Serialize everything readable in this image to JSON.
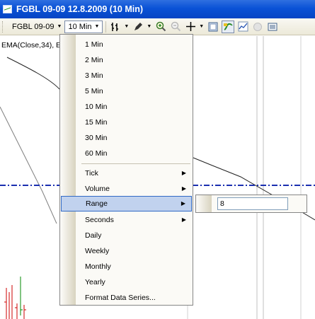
{
  "window": {
    "title": "FGBL 09-09  12.8.2009 (10 Min)"
  },
  "toolbar": {
    "instrument_label": "FGBL 09-09",
    "interval_label": "10 Min"
  },
  "chart": {
    "indicator_label": "EMA(Close,34), E"
  },
  "menu": {
    "items": [
      {
        "label": "1 Min"
      },
      {
        "label": "2 Min"
      },
      {
        "label": "3 Min"
      },
      {
        "label": "5 Min"
      },
      {
        "label": "10 Min"
      },
      {
        "label": "15 Min"
      },
      {
        "label": "30 Min"
      },
      {
        "label": "60 Min"
      },
      {
        "label": "Tick"
      },
      {
        "label": "Volume"
      },
      {
        "label": "Range"
      },
      {
        "label": "Seconds"
      },
      {
        "label": "Daily"
      },
      {
        "label": "Weekly"
      },
      {
        "label": "Monthly"
      },
      {
        "label": "Yearly"
      },
      {
        "label": "Format Data Series..."
      }
    ],
    "highlighted": "Range"
  },
  "submenu": {
    "range_value": "8"
  },
  "colors": {
    "titlebar": "#0a52d6",
    "highlight": "#c1d2ee",
    "dash_line": "#1a2fb0"
  }
}
